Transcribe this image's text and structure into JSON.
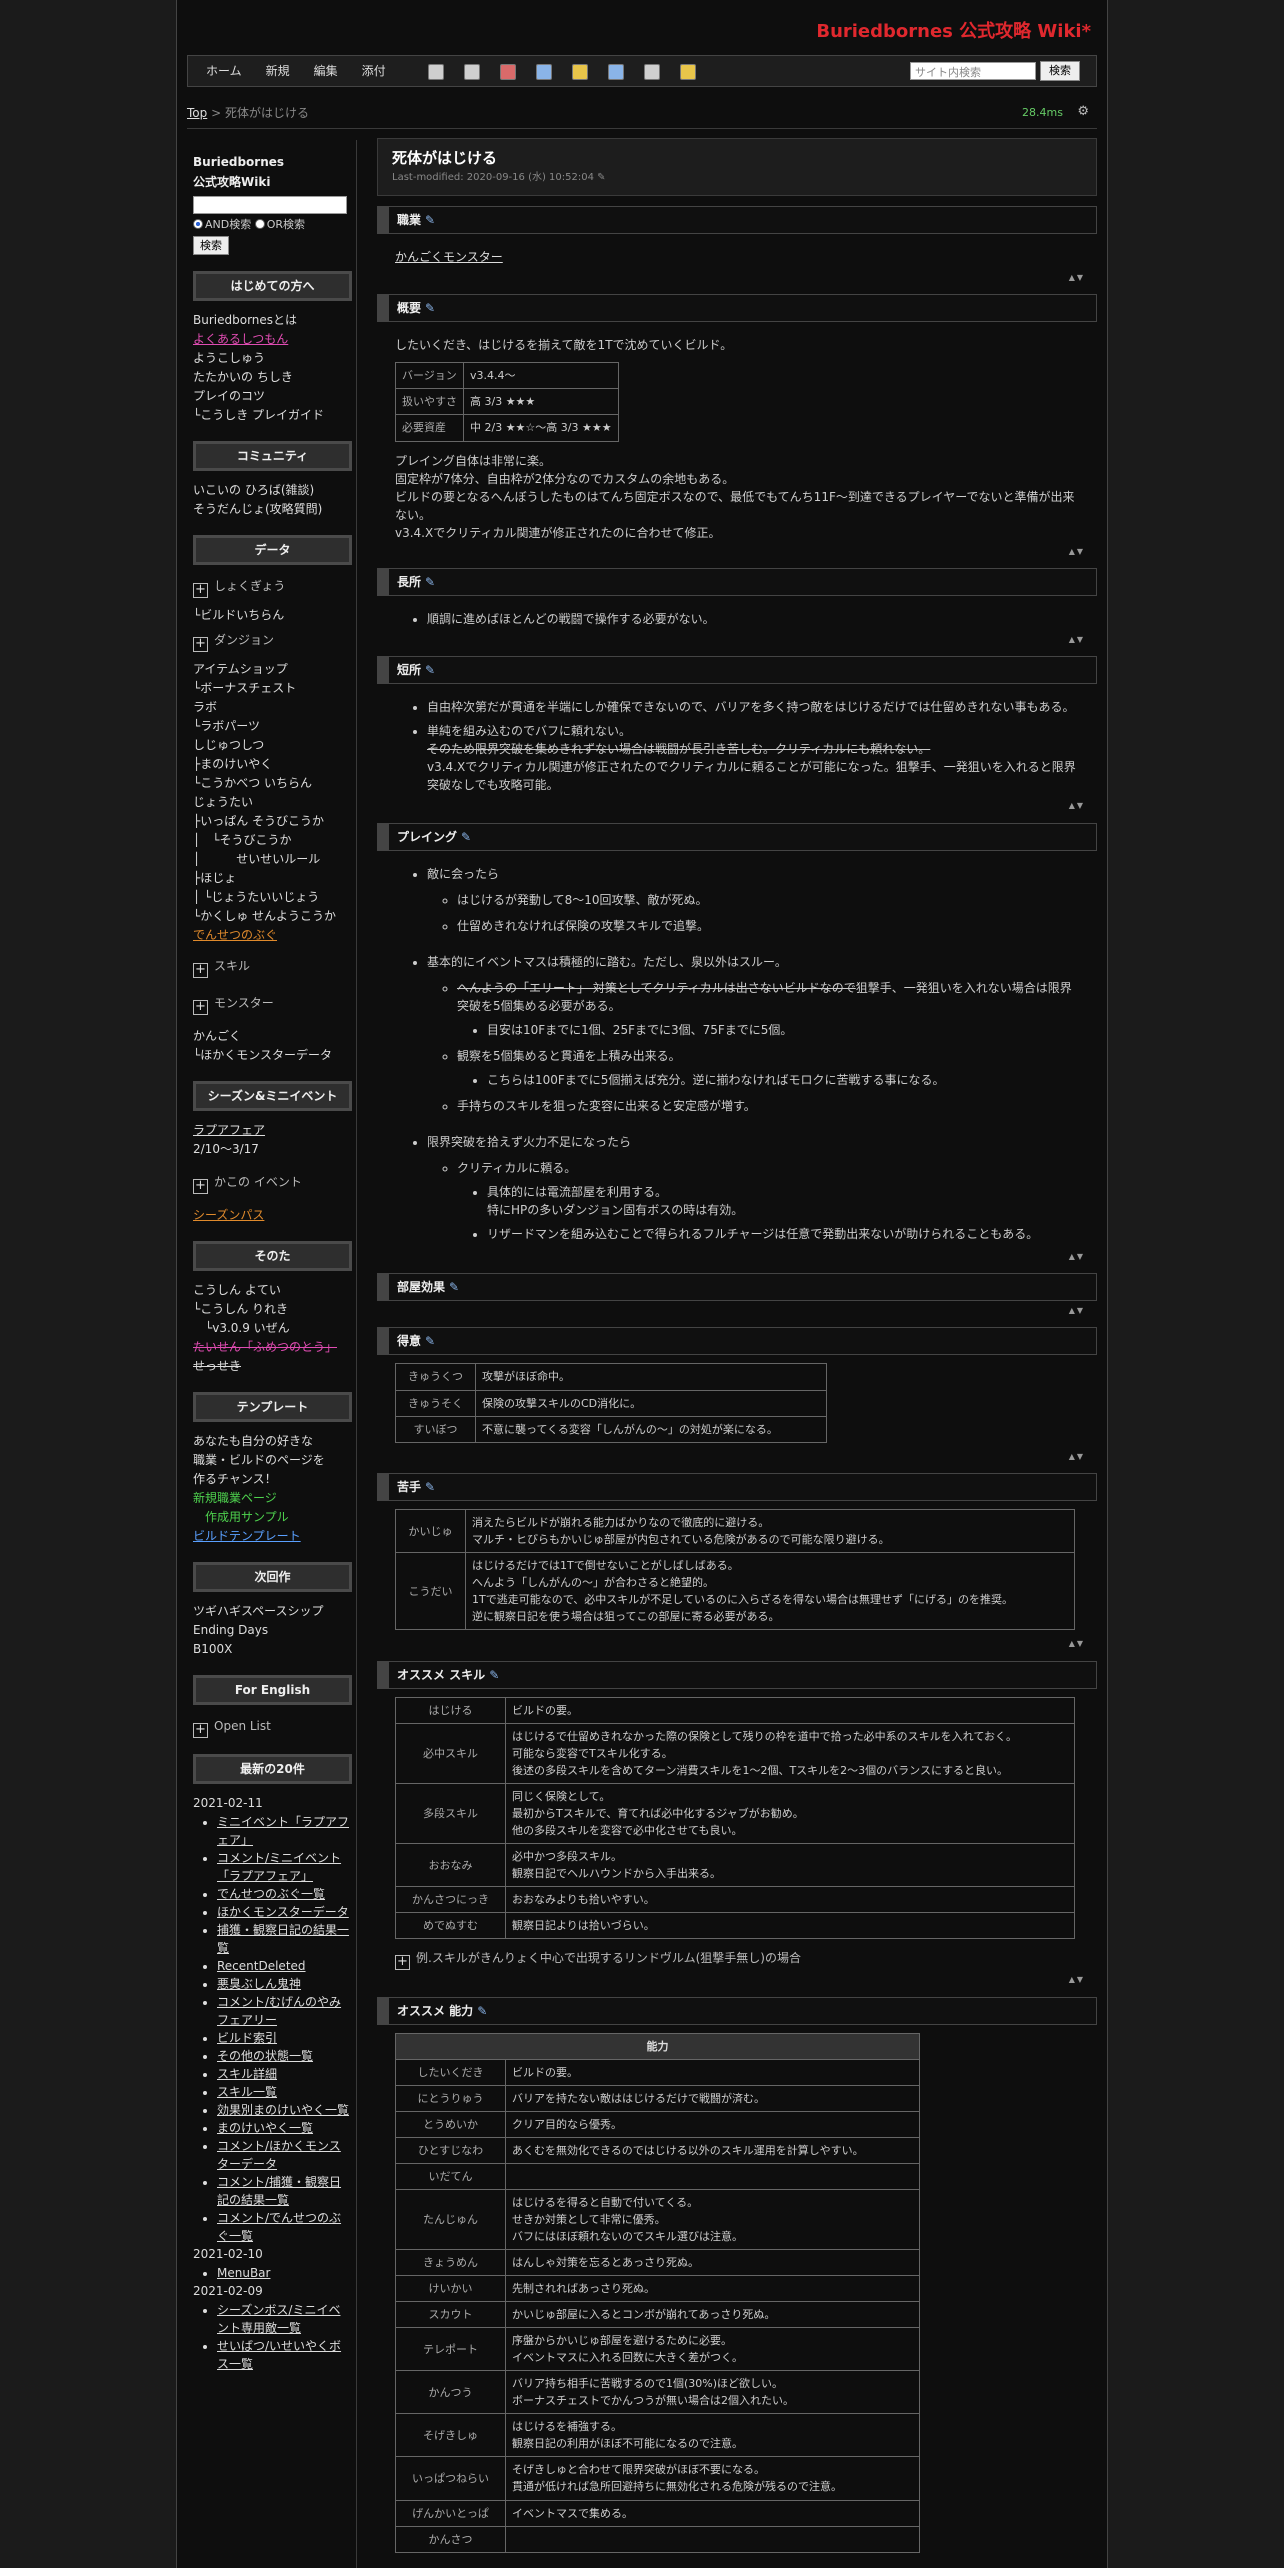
{
  "site_title": "Buriedbornes 公式攻略 Wiki*",
  "menu": {
    "home": "ホーム",
    "new": "新規",
    "edit": "編集",
    "attach": "添付"
  },
  "search": {
    "placeholder": "サイト内検索",
    "button": "検索"
  },
  "breadcrumb": {
    "top": "Top",
    "sep": " > ",
    "current": "死体がはじける"
  },
  "timer": "28.4ms",
  "sidebar": {
    "title1": "Buriedbornes",
    "title2": "公式攻略Wiki",
    "and_label": "AND検索",
    "or_label": "OR検索",
    "search_button": "検索",
    "h_beginner": "はじめての方へ",
    "beginner": [
      "Buriedbornesとは",
      "よくあるしつもん",
      "ようこしゅう",
      "たたかいの ちしき",
      "プレイのコツ",
      "└こうしき プレイガイド"
    ],
    "h_community": "コミュニティ",
    "community": [
      "いこいの ひろば(雑談)",
      "そうだんじょ(攻略質問)"
    ],
    "h_data": "データ",
    "data_expand1": "しょくぎょう",
    "data_a": "└ビルドいちらん",
    "data_expand2": "ダンジョン",
    "data_b": [
      "アイテムショップ",
      "└ボーナスチェスト",
      "ラボ",
      "└ラボパーツ",
      "しじゅつしつ",
      "├まのけいやく",
      "└こうかべつ いちらん",
      "じょうたい",
      "├いっぱん そうびこうか",
      "│　└そうびこうか",
      "│　　　せいせいルール",
      "├ほじょ",
      "│ └じょうたいいじょう",
      "└かくしゅ せんようこうか"
    ],
    "data_c": "でんせつのぶぐ",
    "data_expand3": "スキル",
    "data_expand4": "モンスター",
    "data_d": [
      "かんごく",
      "└ほかくモンスターデータ"
    ],
    "h_season": "シーズン&ミニイベント",
    "season_link": "ラプアフェア",
    "season_date": "2/10～3/17",
    "season_expand": "かこの イベント",
    "season_pass": "シーズンパス",
    "h_other": "そのた",
    "other": [
      "こうしん よてい",
      "└こうしん りれき",
      "　└v3.0.9 いぜん"
    ],
    "other_strike": "たいせん「ふめつのとう」",
    "other_strike2": "せっせき",
    "h_template": "テンプレート",
    "template_text": [
      "あなたも自分の好きな",
      "職業・ビルドのページを",
      "作るチャンス！"
    ],
    "template_links": [
      "新規職業ページ",
      "　作成用サンプル",
      "ビルドテンプレート"
    ],
    "h_next": "次回作",
    "next": [
      "ツギハギスペースシップ",
      "Ending Days",
      "B100X"
    ],
    "h_english": "For English",
    "english_expand": "Open List",
    "h_recent": "最新の20件",
    "recent_date1": "2021-02-11",
    "recent1": [
      "ミニイベント「ラプアフェア」",
      "コメント/ミニイベント「ラプアフェア」",
      "でんせつのぶぐ一覧",
      "ほかくモンスターデータ",
      "捕獲・観察日記の結果一覧",
      "RecentDeleted",
      "悪臭ぶしん鬼神",
      "コメント/むげんのやみ フェアリー",
      "ビルド索引",
      "その他の状態一覧",
      "スキル詳細",
      "スキル一覧",
      "効果別まのけいやく一覧",
      "まのけいやく一覧",
      "コメント/ほかくモンスターデータ",
      "コメント/捕獲・観察日記の結果一覧",
      "コメント/でんせつのぶぐ一覧"
    ],
    "recent_date2": "2021-02-10",
    "recent2": [
      "MenuBar"
    ],
    "recent_date3": "2021-02-09",
    "recent3": [
      "シーズンボス/ミニイベント専用敵一覧",
      "せいばつ/いせいやくボス一覧"
    ]
  },
  "page": {
    "title": "死体がはじける",
    "modified": "Last-modified: 2020-09-16 (水) 10:52:04",
    "h_job": "職業",
    "job_link": "かんごくモンスター",
    "h_overview": "概要",
    "overview_intro": "したいくだき、はじけるを揃えて敵を1Tで沈めていくビルド。",
    "overview_table": [
      [
        "バージョン",
        "v3.4.4～"
      ],
      [
        "扱いやすさ",
        "高 3/3 ★★★"
      ],
      [
        "必要資産",
        "中 2/3 ★★☆～高 3/3 ★★★"
      ]
    ],
    "overview_paras": [
      "プレイング自体は非常に楽。",
      "固定枠が7体分、自由枠が2体分なのでカスタムの余地もある。",
      "ビルドの要となるへんぼうしたものはてんち固定ボスなので、最低でもてんち11F～到達できるプレイヤーでないと準備が出来ない。",
      "v3.4.Xでクリティカル関連が修正されたのに合わせて修正。"
    ],
    "h_merit": "長所",
    "merit": [
      "順調に進めばほとんどの戦闘で操作する必要がない。"
    ],
    "h_demerit": "短所",
    "demerit1": "自由枠次第だが貫通を半端にしか確保できないので、バリアを多く持つ敵をはじけるだけでは仕留めきれない事もある。",
    "demerit2": "単純を組み込むのでバフに頼れない。",
    "demerit2_strike": "そのため限界突破を集めきれずない場合は戦闘が長引き苦しむ。クリティカルにも頼れない。",
    "demerit2_tail": "v3.4.Xでクリティカル関連が修正されたのでクリティカルに頼ることが可能になった。狙撃手、一発狙いを入れると限界突破なしでも攻略可能。",
    "h_play": "プレイング",
    "play1": "敵に会ったら",
    "play1_sub": [
      "はじけるが発動して8～10回攻撃、敵が死ぬ。",
      "仕留めきれなければ保険の攻撃スキルで追撃。"
    ],
    "play2": "基本的にイベントマスは積極的に踏む。ただし、泉以外はスルー。",
    "play2_strike": "へんようの「エリート」 対策としてクリティカルは出さないビルドなので",
    "play2_strike_tail": "狙撃手、一発狙いを入れない場合は限界突破を5個集める必要がある。",
    "play2_sub3": "目安は10Fまでに1個、25Fまでに3個、75Fまでに5個。",
    "play2_b": "観察を5個集めると貫通を上積み出来る。",
    "play2_b_sub": "こちらは100Fまでに5個揃えば充分。逆に揃わなければモロクに苦戦する事になる。",
    "play2_c": "手持ちのスキルを狙った変容に出来ると安定感が増す。",
    "play3": "限界突破を拾えず火力不足になったら",
    "play3_sub": "クリティカルに頼る。",
    "play3_sub3": [
      "具体的には電流部屋を利用する。",
      "特にHPの多いダンジョン固有ボスの時は有効。",
      "リザードマンを組み込むことで得られるフルチャージは任意で発動出来ないが助けられることもある。"
    ],
    "h_room": "部屋効果",
    "h_good": "得意",
    "good_table": [
      [
        "きゅうくつ",
        "攻撃がほぼ命中。"
      ],
      [
        "きゅうそく",
        "保険の攻撃スキルのCD消化に。"
      ],
      [
        "すいぼつ",
        "不意に襲ってくる変容「しんがんの～」の対処が楽になる。"
      ]
    ],
    "h_bad": "苦手",
    "bad_table": [
      [
        "かいじゅ",
        "消えたらビルドが崩れる能力ばかりなので徹底的に避ける。\nマルチ・ヒびらもかいじゅ部屋が内包されている危険があるので可能な限り避ける。"
      ],
      [
        "こうだい",
        "はじけるだけでは1Tで倒せないことがしばしばある。\nへんよう「しんがんの～」が合わさると絶望的。\n1Tで逃走可能なので、必中スキルが不足しているのに入らざるを得ない場合は無理せず「にげる」のを推奨。\n逆に観察日記を使う場合は狙ってこの部屋に寄る必要がある。"
      ]
    ],
    "h_skill": "オススメ スキル",
    "skill_table": [
      [
        "はじける",
        "ビルドの要。"
      ],
      [
        "必中スキル",
        "はじけるで仕留めきれなかった際の保険として残りの枠を道中で拾った必中系のスキルを入れておく。\n可能なら変容でTスキル化する。\n後述の多段スキルを含めてターン消費スキルを1～2個、Tスキルを2～3個のバランスにすると良い。"
      ],
      [
        "多段スキル",
        "同じく保険として。\n最初からTスキルで、育てれば必中化するジャブがお勧め。\n他の多段スキルを変容で必中化させても良い。"
      ],
      [
        "おおなみ",
        "必中かつ多段スキル。\n観察日記でヘルハウンドから入手出来る。"
      ],
      [
        "かんさつにっき",
        "おおなみよりも拾いやすい。"
      ],
      [
        "めでぬすむ",
        "観察日記よりは拾いづらい。"
      ]
    ],
    "skill_expand": "例.スキルがきんりょく中心で出現するリンドヴルム(狙撃手無し)の場合",
    "h_ability": "オススメ 能力",
    "ability_header": "能力",
    "ability_table": [
      [
        "したいくだき",
        "ビルドの要。",
        true
      ],
      [
        "にとうりゅう",
        "バリアを持たない敵ははじけるだけで戦闘が済む。",
        true
      ],
      [
        "とうめいか",
        "クリア目的なら優秀。",
        true
      ],
      [
        "ひとすじなわ",
        "あくむを無効化できるのではじける以外のスキル運用を計算しやすい。",
        true
      ],
      [
        "いだてん",
        "",
        false
      ],
      [
        "たんじゅん",
        "はじけるを得ると自動で付いてくる。\nせきか対策として非常に優秀。\nバフにはほぼ頼れないのでスキル選びは注意。",
        false
      ],
      [
        "きょうめん",
        "はんしゃ対策を忘るとあっさり死ぬ。",
        false
      ],
      [
        "けいかい",
        "先制されればあっさり死ぬ。",
        false
      ],
      [
        "スカウト",
        "かいじゅ部屋に入るとコンボが崩れてあっさり死ぬ。",
        false
      ],
      [
        "テレポート",
        "序盤からかいじゅ部屋を避けるために必要。\nイベントマスに入れる回数に大きく差がつく。",
        false
      ],
      [
        "かんつう",
        "バリア持ち相手に苦戦するので1個(30%)ほど欲しい。\nボーナスチェストでかんつうが無い場合は2個入れたい。",
        false
      ],
      [
        "そげきしゅ",
        "はじけるを補強する。\n観察日記の利用がほぼ不可能になるので注意。",
        false
      ],
      [
        "いっぱつねらい",
        "そげきしゅと合わせて限界突破がほぼ不要になる。\n貫通が低ければ急所回避持ちに無効化される危険が残るので注意。",
        false
      ],
      [
        "げんかいとっぱ",
        "イベントマスで集める。",
        false
      ],
      [
        "かんさつ",
        "",
        false
      ]
    ]
  }
}
